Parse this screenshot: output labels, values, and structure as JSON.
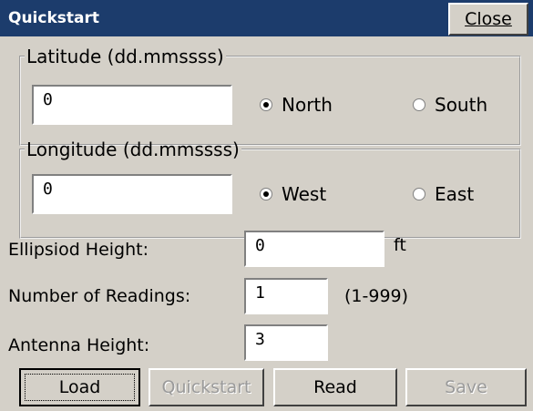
{
  "window": {
    "title": "Quickstart",
    "close_label": "Close"
  },
  "latitude": {
    "legend": "Latitude (dd.mmssss)",
    "value": "0",
    "options": [
      {
        "label": "North",
        "selected": true
      },
      {
        "label": "South",
        "selected": false
      }
    ]
  },
  "longitude": {
    "legend": "Longitude (dd.mmssss)",
    "value": "0",
    "options": [
      {
        "label": "West",
        "selected": true
      },
      {
        "label": "East",
        "selected": false
      }
    ]
  },
  "ellipsoid": {
    "label": "Ellipsiod Height:",
    "value": "0",
    "unit": "ft"
  },
  "readings": {
    "label": "Number of Readings:",
    "value": "1",
    "range": "(1-999)"
  },
  "antenna": {
    "label": "Antenna Height:",
    "value": "3"
  },
  "buttons": {
    "load": "Load",
    "quickstart": "Quickstart",
    "read": "Read",
    "save": "Save"
  }
}
